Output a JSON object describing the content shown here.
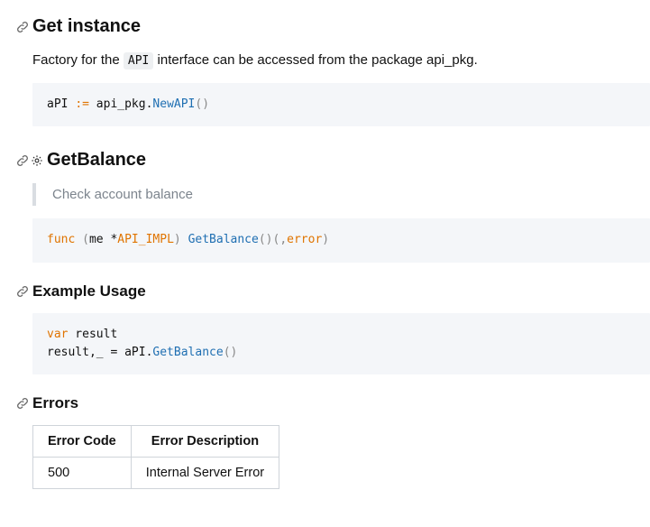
{
  "get_instance": {
    "title": "Get instance",
    "desc_pre": "Factory for the ",
    "desc_code": "API",
    "desc_post": " interface can be accessed from the package api_pkg.",
    "code": {
      "var": "aPI",
      "assign": ":=",
      "pkg": " api_pkg.",
      "fn": "NewAPI",
      "parens": "()"
    }
  },
  "get_balance": {
    "title": "GetBalance",
    "note": "Check account balance",
    "code": {
      "kw": "func",
      "open": " (",
      "recv": "me *",
      "type": "API_IMPL",
      "close_recv": ") ",
      "fn": "GetBalance",
      "sig1": "()(,",
      "err": "error",
      "sig2": ")"
    }
  },
  "example": {
    "title": "Example Usage",
    "code": {
      "kw": "var",
      "rest1": " result \nresult,_ = aPI.",
      "fn": "GetBalance",
      "parens": "()"
    }
  },
  "errors": {
    "title": "Errors",
    "table": {
      "headers": [
        "Error Code",
        "Error Description"
      ],
      "rows": [
        {
          "code": "500",
          "desc": "Internal Server Error"
        }
      ]
    }
  }
}
